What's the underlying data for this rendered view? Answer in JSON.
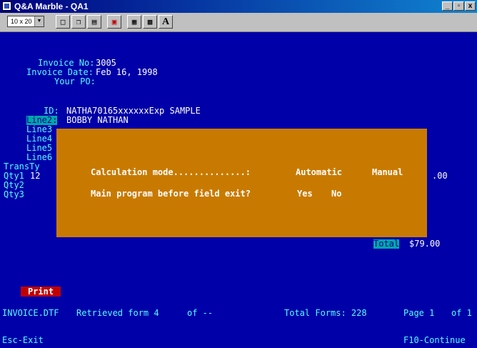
{
  "window": {
    "title": "Q&A Marble - QA1",
    "buttons": [
      "_",
      "̅",
      "x"
    ]
  },
  "toolbar": {
    "font_size": "10 x 20",
    "font_label": "A",
    "icons": [
      "select-icon",
      "copy-icon",
      "paste-icon",
      "fullscreen-icon",
      "properties-icon",
      "background-icon",
      "font-icon"
    ]
  },
  "form": {
    "invoice_no_label": "Invoice No:",
    "invoice_no": "3005",
    "invoice_date_label": "Invoice Date:",
    "invoice_date": "Feb 16, 1998",
    "your_po_label": "Your PO:",
    "id_label": "ID:",
    "id_value": "NATHA70165xxxxxxExp SAMPLE",
    "line2_label": "Line2:",
    "line2_value": "BOBBY NATHAN",
    "line3_label": "Line3",
    "line4_label": "Line4",
    "line5_label": "Line5",
    "line6_label": "Line6",
    "transty_label": "TransTy",
    "qty1_label": "Qty1",
    "qty1_value": "12",
    "qty2_label": "Qty2",
    "qty3_label": "Qty3",
    "amount_value": ".00",
    "total_label": "Total",
    "total_value": "$79.00"
  },
  "dialog": {
    "calc_label": "Calculation mode..............:",
    "calc_automatic": "Automatic",
    "calc_manual": "Manual",
    "main_label": "Main program before field exit?",
    "main_yes": "Yes",
    "main_no": "No"
  },
  "print_button": "Print",
  "status": {
    "file": "INVOICE.DTF",
    "retrieved": "Retrieved form 4",
    "of": "of --",
    "total_forms": "Total Forms: 228",
    "page": "Page 1",
    "page_of": "of 1"
  },
  "footer": {
    "esc": "Esc-Exit",
    "f10": "F10-Continue"
  }
}
